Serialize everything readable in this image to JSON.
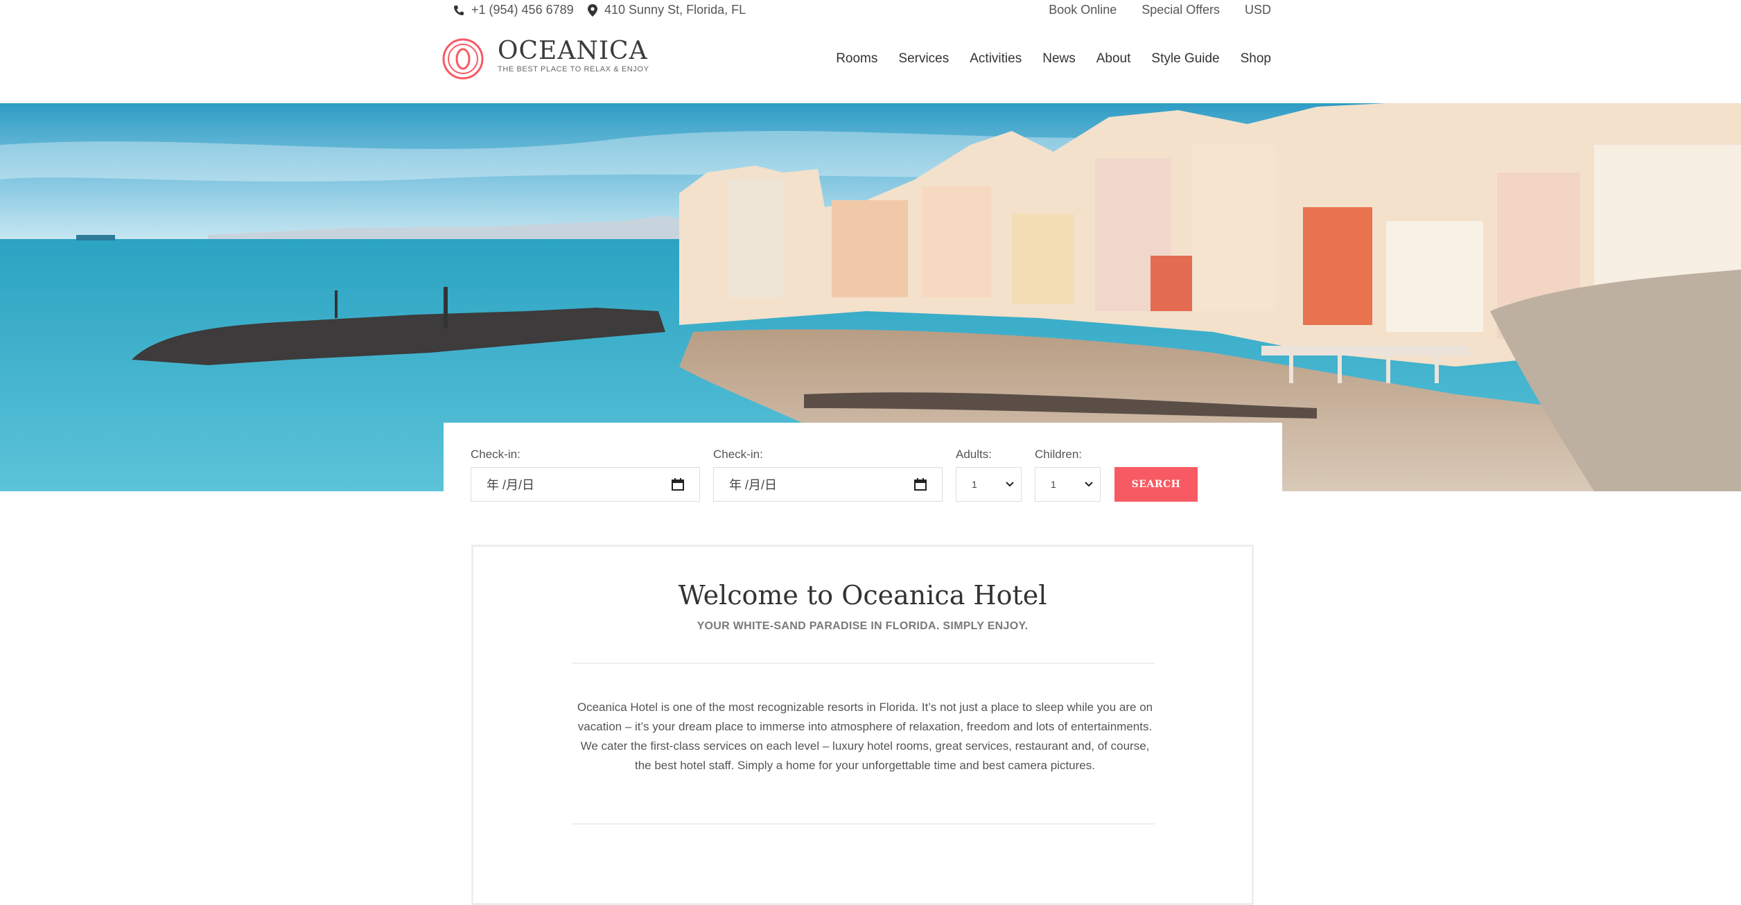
{
  "topbar": {
    "phone": "+1 (954) 456 6789",
    "address": "410 Sunny St, Florida, FL",
    "links": [
      "Book Online",
      "Special Offers",
      "USD"
    ]
  },
  "brand": {
    "name": "OCEANICA",
    "tagline": "THE BEST PLACE TO RELAX & ENJOY",
    "accent_color": "#f85a63"
  },
  "nav": {
    "items": [
      "Rooms",
      "Services",
      "Activities",
      "News",
      "About",
      "Style Guide",
      "Shop"
    ]
  },
  "booking": {
    "checkin_label": "Check-in:",
    "checkout_label": "Check-in:",
    "date_placeholder": "年 /月/日",
    "adults_label": "Adults:",
    "adults_value": "1",
    "children_label": "Children:",
    "children_value": "1",
    "search_label": "SEARCH"
  },
  "welcome": {
    "title": "Welcome to Oceanica Hotel",
    "subtitle": "YOUR WHITE-SAND PARADISE IN FLORIDA. SIMPLY ENJOY.",
    "body": "Oceanica Hotel is one of the most recognizable resorts in Florida. It’s not just a place to sleep while you are on vacation – it’s your dream place to immerse into atmosphere of relaxation, freedom and lots of entertainments. We cater the first-class services on each level – luxury hotel rooms, great services, restaurant and, of course, the best hotel staff. Simply a home for your unforgettable time and best camera pictures."
  }
}
